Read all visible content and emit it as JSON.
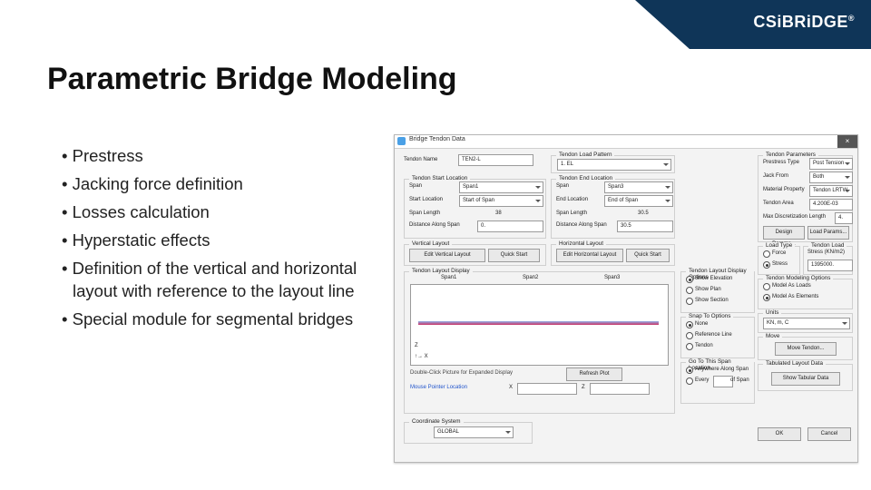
{
  "brand": "CSiBRiDGE",
  "title": "Parametric Bridge Modeling",
  "bullets": [
    "Prestress",
    "Jacking force definition",
    "Losses calculation",
    "Hyperstatic effects",
    "Definition of the vertical and horizontal layout with reference to the layout line",
    "Special module for segmental bridges"
  ],
  "dialog": {
    "title": "Bridge Tendon Data",
    "close": "×",
    "tendon_name_label": "Tendon Name",
    "tendon_name": "TEN2-L",
    "load_pattern": {
      "group": "Tendon Load Pattern",
      "label": "1. EL"
    },
    "params": {
      "group": "Tendon Parameters",
      "prestress_type_l": "Prestress Type",
      "prestress_type": "Post Tension",
      "jack_from_l": "Jack From",
      "jack_from": "Both",
      "material_l": "Material Property",
      "material": "Tendon LRTW",
      "area_l": "Tendon Area",
      "area": "4.200E-03",
      "maxdisc_l": "Max Discretization Length",
      "maxdisc": "4."
    },
    "start": {
      "group": "Tendon Start Location",
      "span_l": "Span",
      "span": "Span1",
      "loc_l": "Start Location",
      "loc": "Start of Span",
      "len_l": "Span Length",
      "len": "38",
      "dist_l": "Distance Along Span",
      "dist": "0."
    },
    "end": {
      "group": "Tendon End Location",
      "span_l": "Span",
      "span": "Span3",
      "loc_l": "End Location",
      "loc": "End of Span",
      "len_l": "Span Length",
      "len": "30.5",
      "dist_l": "Distance Along Span",
      "dist": "30.5"
    },
    "vlay": {
      "group": "Vertical Layout",
      "edit": "Edit Vertical Layout",
      "quick": "Quick Start"
    },
    "hlay": {
      "group": "Horizontal Layout",
      "edit": "Edit Horizontal Layout",
      "quick": "Quick Start"
    },
    "design_params": "Design Params...",
    "load_params": "Load Params...",
    "load_type": {
      "group": "Load Type",
      "force": "Force",
      "stress": "Stress"
    },
    "tendon_load": {
      "group": "Tendon Load",
      "unit": "Stress   (KN/m2)",
      "val": "1395000."
    },
    "display": {
      "group": "Tendon Layout Display",
      "s1": "Span1",
      "s2": "Span2",
      "s3": "Span3",
      "hint": "Double-Click Picture for Expanded Display",
      "refresh": "Refresh Plot",
      "mouse": "Mouse Pointer Location",
      "x": "X",
      "z": "Z"
    },
    "disp_opts": {
      "group": "Tendon Layout Display Options",
      "elev": "Show Elevation",
      "plan": "Show Plan",
      "sect": "Show Section"
    },
    "snap": {
      "group": "Snap To Options",
      "none": "None",
      "ref": "Reference Line",
      "tendon": "Tendon"
    },
    "tabular": {
      "group": "Tabulated Layout Data",
      "every_l": "Anywhere Along Span",
      "every": "Every",
      "of": "of Span",
      "btn": "Show Tabular Data"
    },
    "modeling": {
      "group": "Tendon Modeling Options",
      "loads": "Model As Loads",
      "elems": "Model As Elements"
    },
    "units": {
      "group": "Units",
      "val": "KN, m, C"
    },
    "move": {
      "group": "Move",
      "btn": "Move Tendon..."
    },
    "coord": {
      "group": "Coordinate System",
      "val": "GLOBAL"
    },
    "ok": "OK",
    "cancel": "Cancel"
  }
}
